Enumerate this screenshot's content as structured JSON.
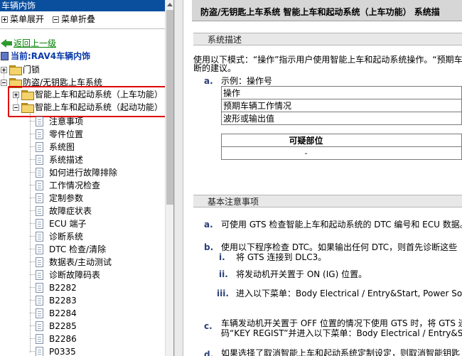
{
  "left_pane": {
    "title": "车辆内饰",
    "toolbar": {
      "expand_label": "菜单展开",
      "collapse_label": "菜单折叠"
    },
    "back_link": "返回上一级",
    "current_label": "当前:RAV4车辆内饰",
    "tree": {
      "door_lock": "门锁",
      "anti_theft": "防盗/无钥匙上车系统",
      "smart_entry": "智能上车和起动系统（上车功能）",
      "smart_start": "智能上车和起动系统（起动功能）",
      "leaves": [
        "注意事项",
        "零件位置",
        "系统图",
        "系统描述",
        "如何进行故障排除",
        "工作情况检查",
        "定制参数",
        "故障症状表",
        "ECU 端子",
        "诊断系统",
        "DTC 检查/清除",
        "数据表/主动测试",
        "诊断故障码表",
        "B2282",
        "B2283",
        "B2284",
        "B2285",
        "B2286",
        "P0335"
      ]
    }
  },
  "right_pane": {
    "header_title": "防盗/无钥匙上车系统  智能上车和起动系统（上车功能）  系统描",
    "section1": {
      "title": "系统描述",
      "intro_line1": "使用以下模式：“操作”指示用户使用智能上车和起动系统操作。“预期车辆",
      "intro_line2": "断的建议。",
      "marker_a": "a.",
      "example_label": "示例：操作号",
      "example_rows": [
        "操作",
        "预期车辆工作情况",
        "波形或输出值"
      ],
      "fault_header": "可疑部位",
      "fault_value": "-"
    },
    "section2": {
      "title": "基本注意事项",
      "items": [
        {
          "marker": "a.",
          "text": "可使用 GTS 检查智能上车和起动系统的 DTC 编号和 ECU 数据。"
        },
        {
          "marker": "b.",
          "text": "使用以下程序检查 DTC。如果输出任何 DTC，则首先诊断这些"
        }
      ],
      "sub_items": [
        {
          "marker": "i.",
          "text": "将 GTS 连接到 DLC3。"
        },
        {
          "marker": "ii.",
          "text": "将发动机开关置于 ON (IG) 位置。"
        },
        {
          "marker": "iii.",
          "text": "进入以下菜单：Body Electrical / Entry&Start, Power Sou"
        }
      ],
      "item_c_marker": "c.",
      "item_c_line1": "车辆发动机开关置于 OFF 位置的情况下使用 GTS 时，将 GTS 连",
      "item_c_line2": "码“KEY REGIST”并进入以下菜单：Body Electrical / Entry&Sta",
      "item_d_marker": "d.",
      "item_d_line1": "如果选择了取消智能上车和起动系统定制设定，则取消智能钥匙"
    }
  },
  "colors": {
    "title_bar": "#0a4f9e",
    "highlight_box": "#e00000",
    "back_link": "#008000",
    "current_label": "#0a3aa8",
    "list_marker": "#2a3f7a"
  }
}
